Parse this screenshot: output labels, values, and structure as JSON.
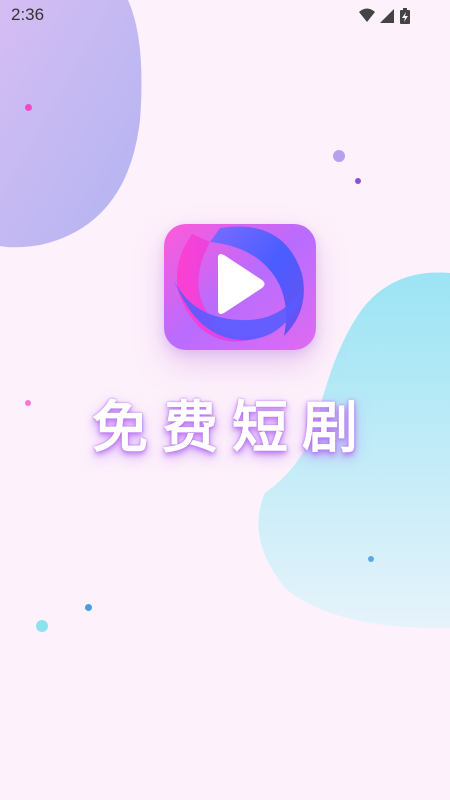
{
  "status_bar": {
    "time": "2:36",
    "icons": [
      "wifi-icon",
      "cellular-signal-icon",
      "battery-charging-icon"
    ]
  },
  "splash": {
    "title": "免费短剧",
    "logo_icon": "play-icon"
  },
  "colors": {
    "background": "#fdf1fb",
    "blob_top_left": "#c3b4f4",
    "blob_right": "#a2e6f4",
    "logo_magenta": "#ff4fd8",
    "logo_blue": "#4b62ff",
    "logo_purple": "#a35bff",
    "title_glow": "#b46cf0"
  }
}
